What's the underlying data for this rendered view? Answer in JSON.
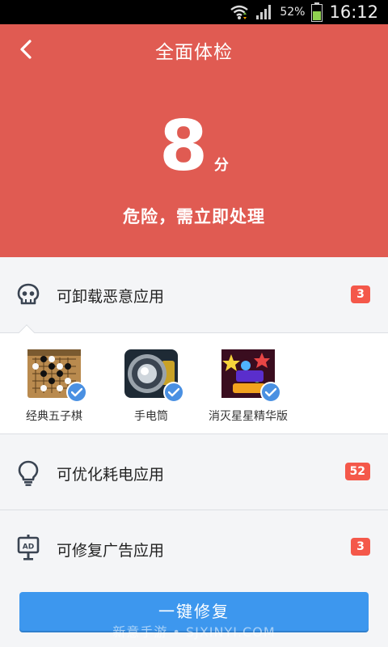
{
  "status_bar": {
    "battery_pct": "52%",
    "time": "16:12"
  },
  "header": {
    "title": "全面体检",
    "score": "8",
    "score_unit": "分",
    "status": "危险，需立即处理",
    "color": "#e05b52"
  },
  "sections": {
    "malicious": {
      "label": "可卸载恶意应用",
      "count": "3",
      "icon": "skull-icon"
    },
    "power": {
      "label": "可优化耗电应用",
      "count": "52",
      "icon": "lightbulb-icon"
    },
    "ads": {
      "label": "可修复广告应用",
      "count": "3",
      "icon": "ad-icon"
    }
  },
  "apps": [
    {
      "name": "经典五子棋",
      "icon": "gomoku-app-icon",
      "checked": true
    },
    {
      "name": "手电筒",
      "icon": "flashlight-app-icon",
      "checked": true
    },
    {
      "name": "消灭星星精华版",
      "icon": "popstar-app-icon",
      "checked": true
    }
  ],
  "action": {
    "fix_label": "一键修复",
    "accent": "#3d97ee"
  },
  "watermark": "新意手游 • SJXINYI.COM"
}
